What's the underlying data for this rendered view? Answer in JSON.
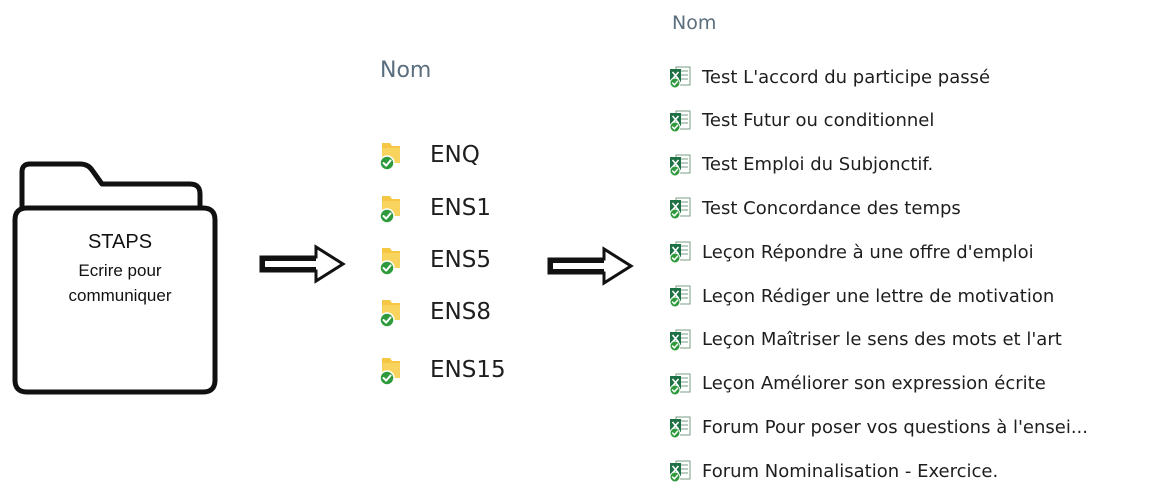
{
  "source_folder": {
    "title": "STAPS",
    "subtitle_line1": "Ecrire pour",
    "subtitle_line2": "communiquer"
  },
  "middle_list": {
    "header": "Nom",
    "items": [
      {
        "label": "ENQ",
        "icon": "folder-synced-icon"
      },
      {
        "label": "ENS1",
        "icon": "folder-synced-icon"
      },
      {
        "label": "ENS5",
        "icon": "folder-synced-icon"
      },
      {
        "label": "ENS8",
        "icon": "folder-synced-icon"
      },
      {
        "label": "ENS15",
        "icon": "folder-synced-icon"
      }
    ]
  },
  "right_list": {
    "header": "Nom",
    "items": [
      {
        "label": "Test L'accord du participe passé",
        "icon": "excel-file-synced-icon"
      },
      {
        "label": "Test Futur ou conditionnel",
        "icon": "excel-file-synced-icon"
      },
      {
        "label": "Test Emploi du Subjonctif.",
        "icon": "excel-file-synced-icon"
      },
      {
        "label": "Test Concordance des temps",
        "icon": "excel-file-synced-icon"
      },
      {
        "label": "Leçon Répondre à une offre d'emploi",
        "icon": "excel-file-synced-icon"
      },
      {
        "label": "Leçon Rédiger une lettre de motivation",
        "icon": "excel-file-synced-icon"
      },
      {
        "label": "Leçon Maîtriser le sens des mots et l'art",
        "icon": "excel-file-synced-icon"
      },
      {
        "label": "Leçon Améliorer son expression écrite",
        "icon": "excel-file-synced-icon"
      },
      {
        "label": "Forum Pour poser vos questions à l'ensei...",
        "icon": "excel-file-synced-icon"
      },
      {
        "label": "Forum Nominalisation - Exercice.",
        "icon": "excel-file-synced-icon"
      }
    ]
  },
  "colors": {
    "folder_yellow": "#f6c744",
    "sync_green": "#2e9a3c",
    "excel_green": "#1e7145"
  }
}
